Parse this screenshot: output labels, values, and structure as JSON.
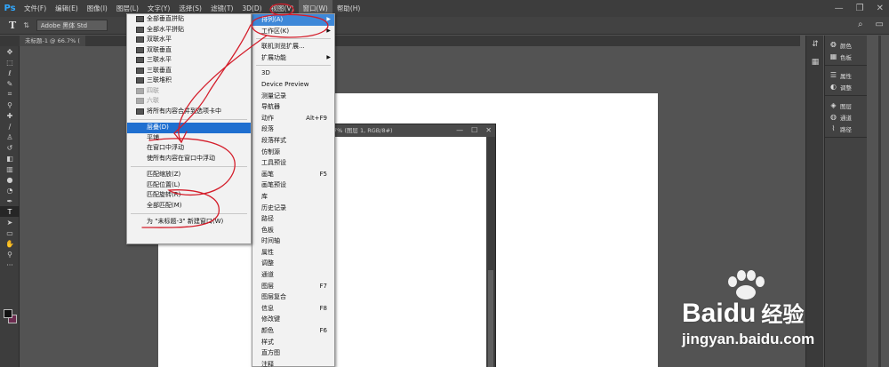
{
  "app": {
    "logo": "Ps"
  },
  "menubar": {
    "items": [
      {
        "label": "文件(F)"
      },
      {
        "label": "编辑(E)"
      },
      {
        "label": "图像(I)"
      },
      {
        "label": "图层(L)"
      },
      {
        "label": "文字(Y)"
      },
      {
        "label": "选择(S)"
      },
      {
        "label": "滤镜(T)"
      },
      {
        "label": "3D(D)"
      },
      {
        "label": "视图(V)"
      },
      {
        "label": "窗口(W)",
        "active": true
      },
      {
        "label": "帮助(H)"
      }
    ]
  },
  "window_controls": {
    "minimize": "—",
    "restore": "❐",
    "close": "✕"
  },
  "options_bar": {
    "tool_glyph": "T",
    "orient_glyph": "⇅",
    "font_family": "Adobe 黑体 Std",
    "search_glyph": "⌕",
    "workspace_glyph": "▭"
  },
  "document_tab": {
    "label": "未标题-1 @ 66.7% ("
  },
  "document_window": {
    "title": "7% (图层 1, RGB/8#)",
    "min": "—",
    "max": "☐",
    "close": "✕"
  },
  "window_menu": {
    "items": [
      {
        "label": "排列(A)",
        "submenu": true,
        "highlighted": true
      },
      {
        "label": "工作区(K)",
        "submenu": true
      },
      {
        "sep": true
      },
      {
        "label": "联机浏览扩展..."
      },
      {
        "label": "扩展功能",
        "submenu": true
      },
      {
        "sep": true
      },
      {
        "label": "3D"
      },
      {
        "label": "Device Preview"
      },
      {
        "label": "测量记录"
      },
      {
        "label": "导航器"
      },
      {
        "label": "动作",
        "shortcut": "Alt+F9"
      },
      {
        "label": "段落"
      },
      {
        "label": "段落样式"
      },
      {
        "label": "仿制源"
      },
      {
        "label": "工具预设"
      },
      {
        "label": "画笔",
        "shortcut": "F5"
      },
      {
        "label": "画笔预设"
      },
      {
        "label": "库"
      },
      {
        "label": "历史记录"
      },
      {
        "label": "路径"
      },
      {
        "label": "色板"
      },
      {
        "label": "时间轴"
      },
      {
        "label": "属性"
      },
      {
        "label": "调整"
      },
      {
        "label": "通道"
      },
      {
        "label": "图层",
        "shortcut": "F7"
      },
      {
        "label": "图层复合"
      },
      {
        "label": "信息",
        "shortcut": "F8"
      },
      {
        "label": "修改键"
      },
      {
        "label": "颜色",
        "shortcut": "F6"
      },
      {
        "label": "样式"
      },
      {
        "label": "直方图"
      },
      {
        "label": "注释"
      }
    ]
  },
  "arrange_menu": {
    "items": [
      {
        "label": "全部垂直拼贴",
        "icon": true
      },
      {
        "label": "全部水平拼贴",
        "icon": true
      },
      {
        "label": "双联水平",
        "icon": true
      },
      {
        "label": "双联垂直",
        "icon": true
      },
      {
        "label": "三联水平",
        "icon": true
      },
      {
        "label": "三联垂直",
        "icon": true
      },
      {
        "label": "三联堆积",
        "icon": true
      },
      {
        "label": "四联",
        "icon": true,
        "disabled": true
      },
      {
        "label": "六联",
        "icon": true,
        "disabled": true
      },
      {
        "label": "将所有内容合并到选项卡中",
        "icon": true
      },
      {
        "sep": true
      },
      {
        "label": "层叠(D)",
        "highlighted": true
      },
      {
        "label": "平铺"
      },
      {
        "label": "在窗口中浮动"
      },
      {
        "label": "使所有内容在窗口中浮动"
      },
      {
        "sep": true
      },
      {
        "label": "匹配缩放(Z)"
      },
      {
        "label": "匹配位置(L)"
      },
      {
        "label": "匹配旋转(R)"
      },
      {
        "label": "全部匹配(M)"
      },
      {
        "sep": true
      },
      {
        "label": "为 \"未标题-3\" 新建窗口(W)"
      }
    ]
  },
  "toolbar": {
    "tools": [
      {
        "name": "move-tool",
        "glyph": "✥"
      },
      {
        "name": "marquee-tool",
        "glyph": "⬚"
      },
      {
        "name": "lasso-tool",
        "glyph": "ℓ"
      },
      {
        "name": "quick-select-tool",
        "glyph": "✎"
      },
      {
        "name": "crop-tool",
        "glyph": "⌗"
      },
      {
        "name": "eyedropper-tool",
        "glyph": "⚲"
      },
      {
        "name": "healing-tool",
        "glyph": "✚"
      },
      {
        "name": "brush-tool",
        "glyph": "∕"
      },
      {
        "name": "stamp-tool",
        "glyph": "♙"
      },
      {
        "name": "history-brush-tool",
        "glyph": "↺"
      },
      {
        "name": "eraser-tool",
        "glyph": "◧"
      },
      {
        "name": "gradient-tool",
        "glyph": "▥"
      },
      {
        "name": "blur-tool",
        "glyph": "●"
      },
      {
        "name": "dodge-tool",
        "glyph": "◔"
      },
      {
        "name": "pen-tool",
        "glyph": "✒"
      },
      {
        "name": "type-tool",
        "glyph": "T",
        "selected": true
      },
      {
        "name": "path-select-tool",
        "glyph": "➤"
      },
      {
        "name": "shape-tool",
        "glyph": "▭"
      },
      {
        "name": "hand-tool",
        "glyph": "✋"
      },
      {
        "name": "zoom-tool",
        "glyph": "⚲"
      },
      {
        "name": "more-tools",
        "glyph": "···"
      }
    ],
    "foreground_color": "#111111",
    "background_color": "#6c2b4f"
  },
  "right_panels": {
    "strip_icons": [
      "⇵",
      "▦"
    ],
    "groups": [
      [
        {
          "icon": "❂",
          "label": "颜色"
        },
        {
          "icon": "▦",
          "label": "色板"
        }
      ],
      [
        {
          "icon": "☰",
          "label": "属性"
        },
        {
          "icon": "◐",
          "label": "调整"
        }
      ],
      [
        {
          "icon": "◈",
          "label": "图层"
        },
        {
          "icon": "◍",
          "label": "通道"
        },
        {
          "icon": "⌇",
          "label": "路径"
        }
      ]
    ]
  },
  "watermark": {
    "brand_a": "Bai",
    "brand_b": "du",
    "brand_c": "经验",
    "url": "jingyan.baidu.com"
  },
  "colors": {
    "highlight": "#3e88d8",
    "annotation": "#d41e2b",
    "canvas": "#ffffff",
    "workspace": "#535353"
  }
}
